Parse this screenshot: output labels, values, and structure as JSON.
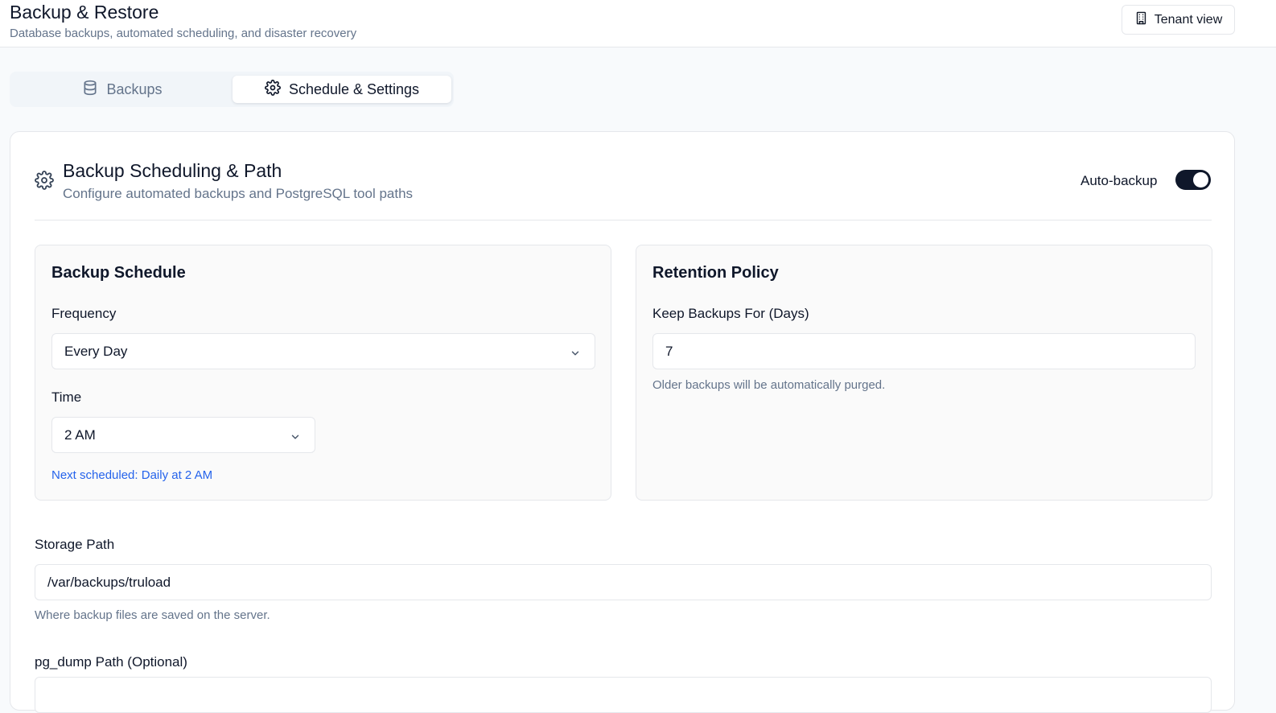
{
  "header": {
    "title": "Backup & Restore",
    "subtitle": "Database backups, automated scheduling, and disaster recovery",
    "tenant_button": "Tenant view"
  },
  "tabs": [
    {
      "label": "Backups",
      "icon": "database-icon",
      "active": false
    },
    {
      "label": "Schedule & Settings",
      "icon": "gear-icon",
      "active": true
    }
  ],
  "card": {
    "icon": "gear-icon",
    "title": "Backup Scheduling & Path",
    "description": "Configure automated backups and PostgreSQL tool paths",
    "auto_backup_label": "Auto-backup",
    "auto_backup_enabled": true
  },
  "schedule": {
    "title": "Backup Schedule",
    "frequency_label": "Frequency",
    "frequency_value": "Every Day",
    "time_label": "Time",
    "time_value": "2 AM",
    "next_scheduled": "Next scheduled: Daily at 2 AM"
  },
  "retention": {
    "title": "Retention Policy",
    "keep_label": "Keep Backups For (Days)",
    "keep_value": "7",
    "help": "Older backups will be automatically purged."
  },
  "storage": {
    "label": "Storage Path",
    "value": "/var/backups/truload",
    "help": "Where backup files are saved on the server."
  },
  "pg_dump": {
    "label": "pg_dump Path (Optional)"
  },
  "colors": {
    "accent": "#0f172a",
    "link": "#2563eb",
    "muted": "#64748b",
    "border": "#e5e7eb"
  }
}
